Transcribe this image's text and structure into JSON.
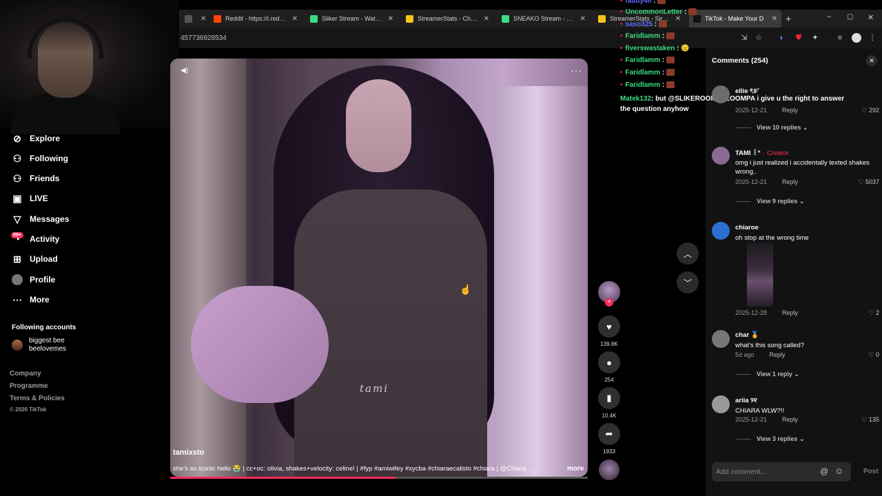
{
  "browser": {
    "tabs": [
      {
        "label": "- You",
        "color": "#555555"
      },
      {
        "label": "Reddit - https://i.redd.it/0",
        "color": "#ff4500"
      },
      {
        "label": "Sliker Stream - Watch Liv",
        "color": "#3ddc84"
      },
      {
        "label": "StreamerStats - Cheeseef",
        "color": "#f5c518"
      },
      {
        "label": "SNEAKO Stream - Watch",
        "color": "#3ddc84"
      },
      {
        "label": "StreamerStats - SirSugar",
        "color": "#f5c518"
      },
      {
        "label": "TikTok - Make Your D",
        "color": "#111111"
      }
    ],
    "new_tab": "+",
    "url_fragment": "457736928534",
    "window_controls": [
      "–",
      "▢",
      "✕"
    ]
  },
  "sidebar": {
    "nav": [
      {
        "label": "Explore",
        "icon": "compass-icon",
        "glyph": "⊘"
      },
      {
        "label": "Following",
        "icon": "person-icon",
        "glyph": "⚇"
      },
      {
        "label": "Friends",
        "icon": "friends-icon",
        "glyph": "⚇"
      },
      {
        "label": "LIVE",
        "icon": "live-icon",
        "glyph": "▣"
      },
      {
        "label": "Messages",
        "icon": "inbox-icon",
        "glyph": "▽"
      },
      {
        "label": "Activity",
        "icon": "bell-icon",
        "glyph": "◔"
      },
      {
        "label": "Upload",
        "icon": "upload-icon",
        "glyph": "⊞"
      },
      {
        "label": "Profile",
        "icon": "avatar-icon",
        "glyph": "●"
      },
      {
        "label": "More",
        "icon": "more-dots-icon",
        "glyph": "⋯"
      }
    ],
    "activity_badge": "99+",
    "following_title": "Following accounts",
    "following": {
      "name": "biggest bee",
      "handle": "beelovemes"
    },
    "footer": [
      "Company",
      "Programme",
      "Terms & Policies",
      "© 2026 TikTok"
    ]
  },
  "video": {
    "author": "tamixsto",
    "caption": "she's so iconic hello 😭 | cc+oc: olivia, shakes+velocity: celine! | #fyp #amiwifey #xycba #chiaraecalisto #chiara | @Chiara ...",
    "more": "more",
    "watermark": "tami",
    "progress": 0.54
  },
  "actions": {
    "likes": "139.8K",
    "comments": "254",
    "saves": "10.4K",
    "shares": "1933"
  },
  "stream_chat": [
    {
      "user": "fauuy48",
      "color": "#5b6cff",
      "msg": ""
    },
    {
      "user": "UncommonLetter",
      "color": "#3ddc84",
      "msg": ""
    },
    {
      "user": "saso325",
      "color": "#5b6cff",
      "msg": ""
    },
    {
      "user": "Faridlamm",
      "color": "#3ddc84",
      "msg": ""
    },
    {
      "user": "fiverswastaken",
      "color": "#3ddc84",
      "msg": "😐"
    },
    {
      "user": "Faridlamm",
      "color": "#3ddc84",
      "msg": ""
    },
    {
      "user": "Faridlamm",
      "color": "#3ddc84",
      "msg": ""
    },
    {
      "user": "Faridlamm",
      "color": "#3ddc84",
      "msg": ""
    },
    {
      "user": "Matek132",
      "color": "#3ddc84",
      "msg": ": but @SLIKEROOMPALOOMPA i give u the right to answer the question anyhow"
    }
  ],
  "comments": {
    "title": "Comments (254)",
    "items": [
      {
        "name": "ellie ৎ୭˚",
        "text": "",
        "date": "2025-12-21",
        "reply": "Reply",
        "likes": "292",
        "view_replies": "View 10 replies",
        "avatar": "#6d6d6d"
      },
      {
        "name": "TAMI ꒰ᐢ",
        "creator": "· Creator",
        "text": "omg i just realized i accidentally texted shakes wrong..",
        "date": "2025-12-21",
        "reply": "Reply",
        "likes": "5037",
        "view_replies": "View 9 replies",
        "avatar": "#8a6a95"
      },
      {
        "name": "chiaroe",
        "text": "oh stop at the wrong time",
        "date": "2025-12-28",
        "reply": "Reply",
        "likes": "2",
        "view_replies": "",
        "avatar": "#2d6fd0"
      },
      {
        "name": "char 🏅",
        "text": "what's this song called?",
        "date": "5d ago",
        "reply": "Reply",
        "likes": "0",
        "view_replies": "View 1 reply",
        "avatar": "#777777"
      },
      {
        "name": "ariia ୨୧",
        "text": "CHIARA WLW?!!",
        "date": "2025-12-21",
        "reply": "Reply",
        "likes": "135",
        "view_replies": "View 3 replies",
        "avatar": "#9a9a9a"
      }
    ],
    "add_placeholder": "Add comment...",
    "post": "Post"
  },
  "colors": {
    "accent": "#fe2c55",
    "panel_bg": "#121212"
  }
}
